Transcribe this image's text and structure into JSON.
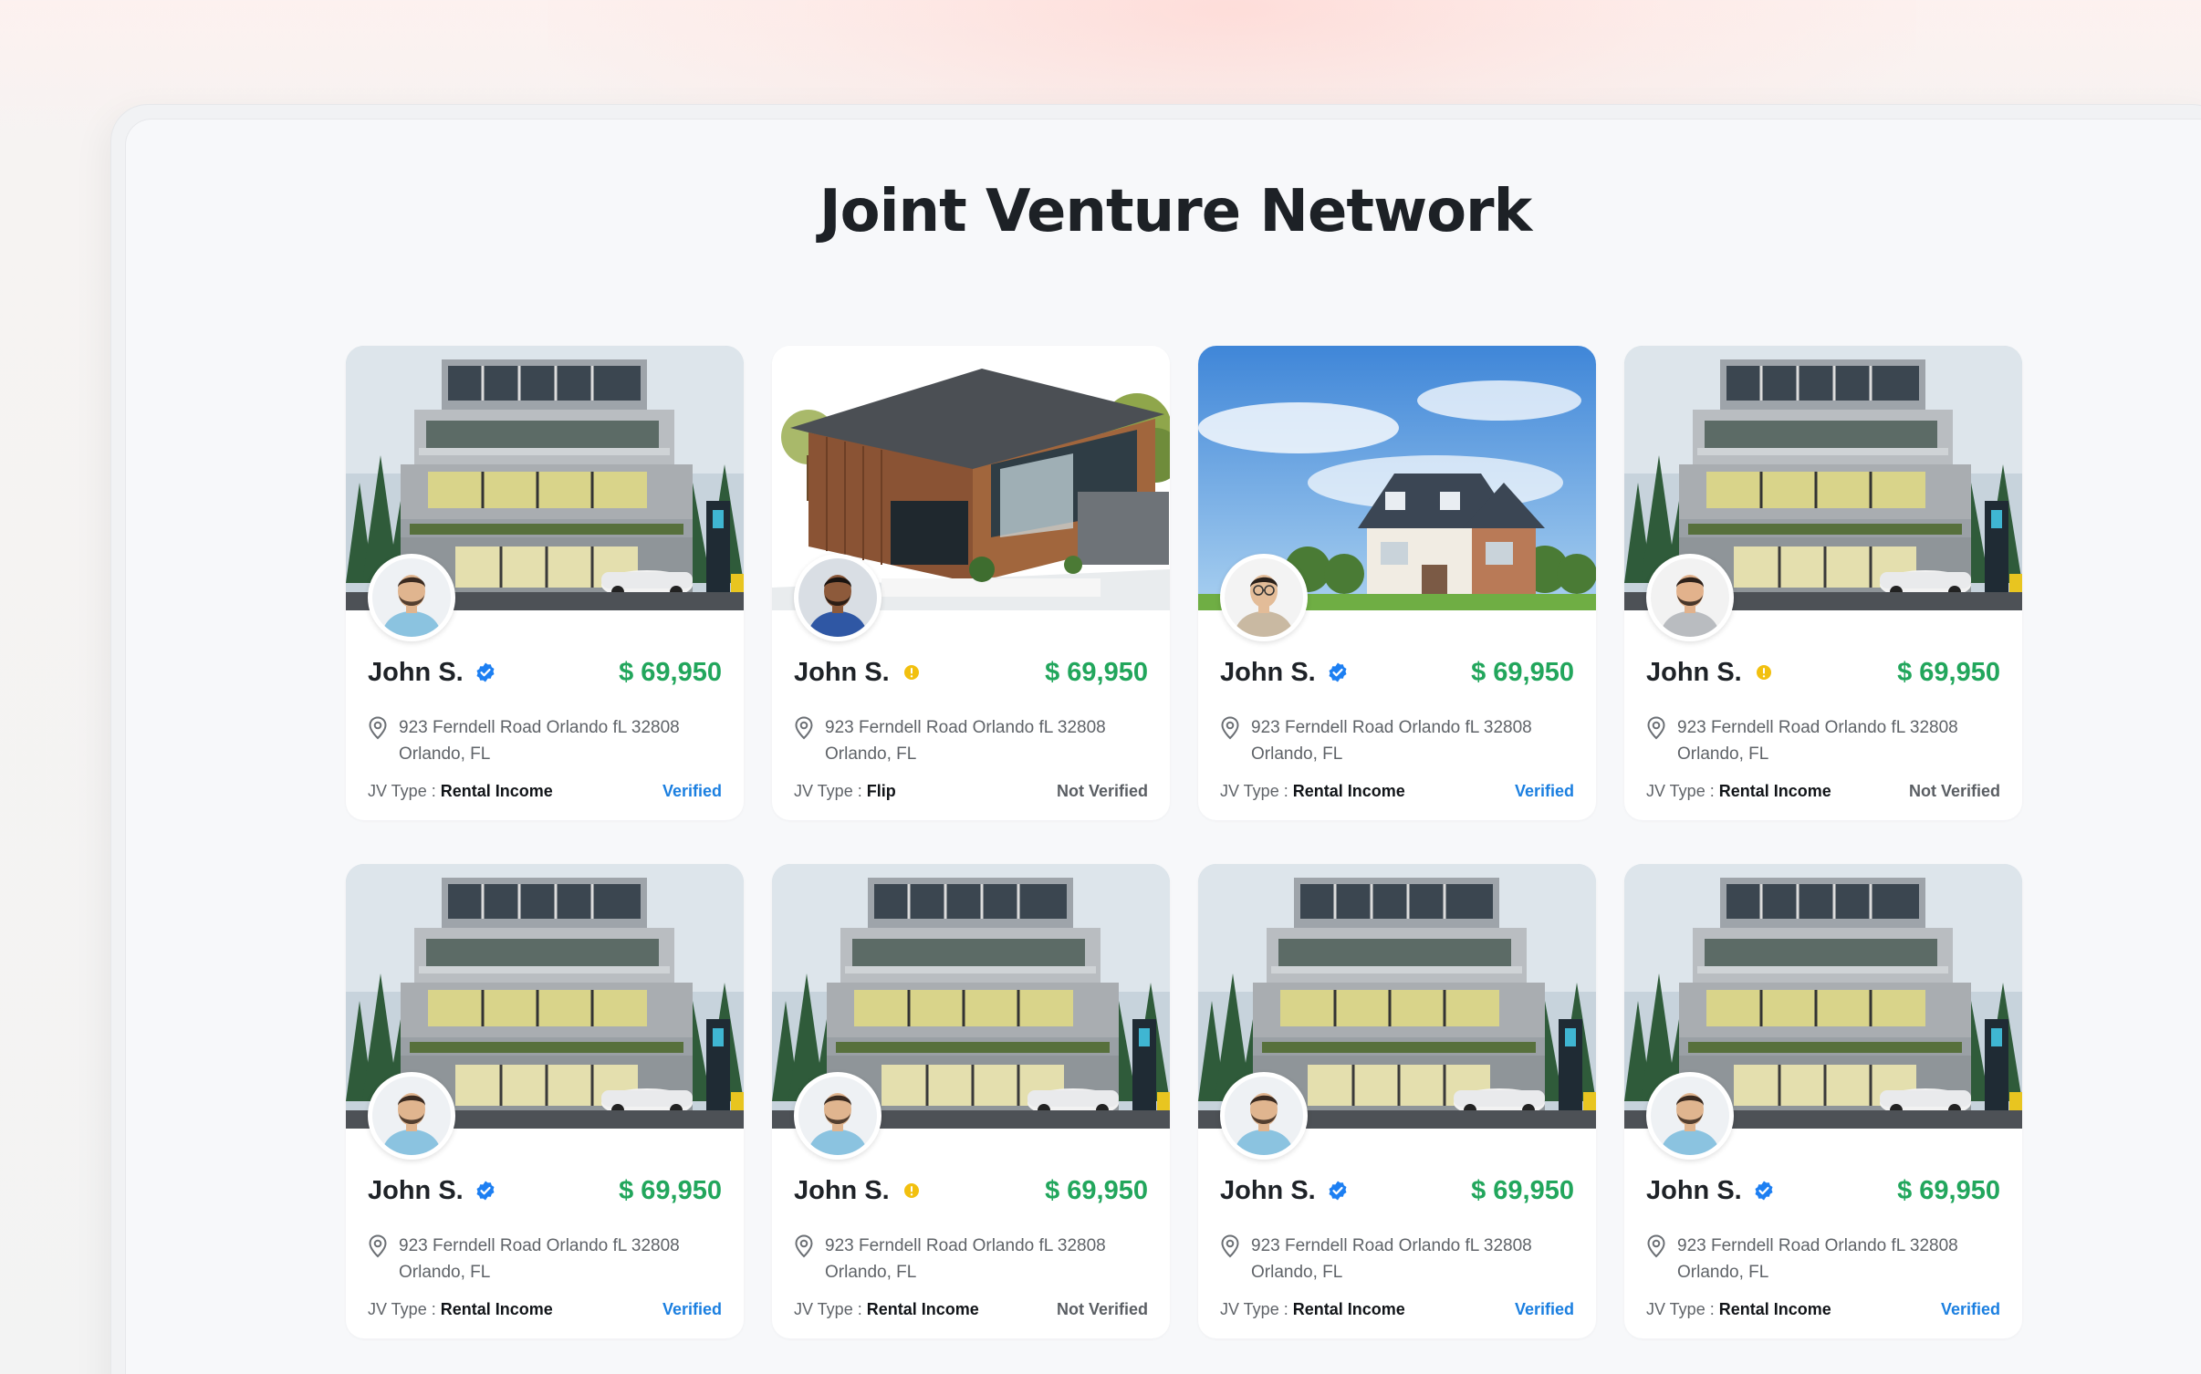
{
  "page": {
    "title": "Joint Venture Network"
  },
  "colors": {
    "price": "#22a65c",
    "verified": "#1b7fe0",
    "not_verified": "#5a5e63",
    "badge_verified": "#1d7ff2",
    "badge_pending": "#f2c00f"
  },
  "labels": {
    "jv_type": "JV Type : "
  },
  "cards": [
    {
      "name": "John S.",
      "badge": "verified-badge-icon",
      "price": "$ 69,950",
      "address_line1": "923 Ferndell Road Orlando fL 32808",
      "address_line2": "Orlando, FL",
      "jv_type": "Rental Income",
      "status": "Verified",
      "image": "modern-apartment",
      "avatar": "man-beard-light"
    },
    {
      "name": "John S.",
      "badge": "pending-badge-icon",
      "price": "$ 69,950",
      "address_line1": "923 Ferndell Road Orlando fL 32808",
      "address_line2": "Orlando, FL",
      "jv_type": "Flip",
      "status": "Not Verified",
      "image": "wood-house",
      "avatar": "man-dark"
    },
    {
      "name": "John S.",
      "badge": "verified-badge-icon",
      "price": "$ 69,950",
      "address_line1": "923 Ferndell Road Orlando fL 32808",
      "address_line2": "Orlando, FL",
      "jv_type": "Rental Income",
      "status": "Verified",
      "image": "brick-house",
      "avatar": "man-glasses"
    },
    {
      "name": "John S.",
      "badge": "pending-badge-icon",
      "price": "$ 69,950",
      "address_line1": "923 Ferndell Road Orlando fL 32808",
      "address_line2": "Orlando, FL",
      "jv_type": "Rental Income",
      "status": "Not Verified",
      "image": "modern-apartment",
      "avatar": "man-grey-shirt"
    },
    {
      "name": "John S.",
      "badge": "verified-badge-icon",
      "price": "$ 69,950",
      "address_line1": "923 Ferndell Road Orlando fL 32808",
      "address_line2": "Orlando, FL",
      "jv_type": "Rental Income",
      "status": "Verified",
      "image": "modern-apartment",
      "avatar": "man-beard-light"
    },
    {
      "name": "John S.",
      "badge": "pending-badge-icon",
      "price": "$ 69,950",
      "address_line1": "923 Ferndell Road Orlando fL 32808",
      "address_line2": "Orlando, FL",
      "jv_type": "Rental Income",
      "status": "Not Verified",
      "image": "modern-apartment",
      "avatar": "man-beard-light"
    },
    {
      "name": "John S.",
      "badge": "verified-badge-icon",
      "price": "$ 69,950",
      "address_line1": "923 Ferndell Road Orlando fL 32808",
      "address_line2": "Orlando, FL",
      "jv_type": "Rental Income",
      "status": "Verified",
      "image": "modern-apartment",
      "avatar": "man-beard-light"
    },
    {
      "name": "John S.",
      "badge": "verified-badge-icon",
      "price": "$ 69,950",
      "address_line1": "923 Ferndell Road Orlando fL 32808",
      "address_line2": "Orlando, FL",
      "jv_type": "Rental Income",
      "status": "Verified",
      "image": "modern-apartment",
      "avatar": "man-beard-light"
    }
  ]
}
